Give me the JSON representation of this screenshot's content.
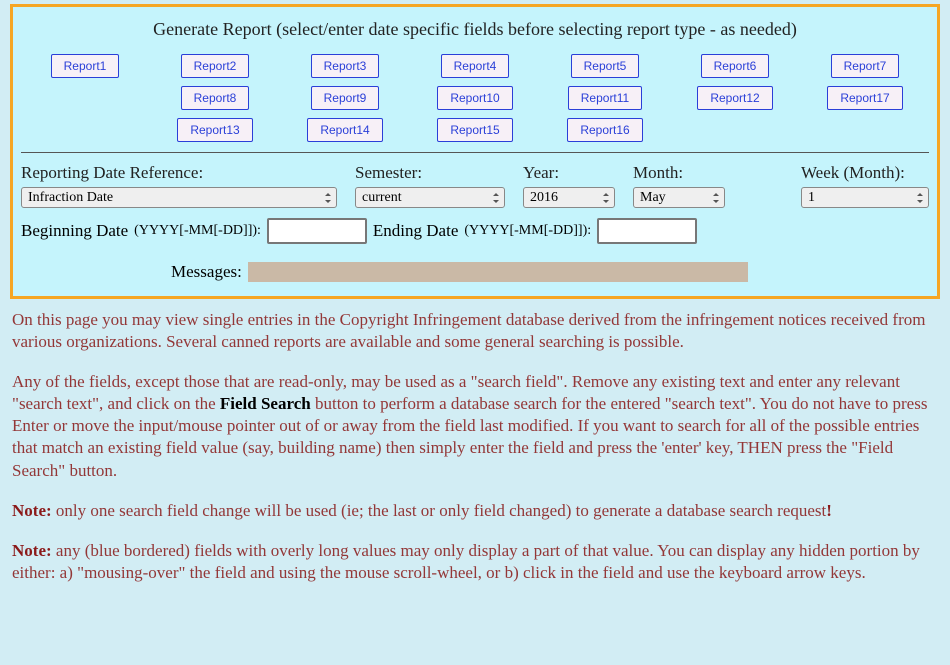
{
  "panel": {
    "title": "Generate Report (select/enter date specific fields before selecting report type - as needed)"
  },
  "reports": [
    [
      "Report1",
      "Report2",
      "Report3",
      "Report4",
      "Report5",
      "Report6",
      "Report7"
    ],
    [
      "",
      "Report8",
      "Report9",
      "Report10",
      "Report11",
      "Report12",
      "Report17"
    ],
    [
      "",
      "Report13",
      "Report14",
      "Report15",
      "Report16",
      "",
      ""
    ]
  ],
  "controls": {
    "reporting_date_ref": {
      "label": "Reporting Date Reference:",
      "value": "Infraction Date"
    },
    "semester": {
      "label": "Semester:",
      "value": "current"
    },
    "year": {
      "label": "Year:",
      "value": "2016"
    },
    "month": {
      "label": "Month:",
      "value": "May"
    },
    "week": {
      "label": "Week (Month):",
      "value": "1"
    }
  },
  "dates": {
    "begin_label": "Beginning Date",
    "begin_fmt": "(YYYY[-MM[-DD]]):",
    "end_label": "Ending Date",
    "end_fmt": "(YYYY[-MM[-DD]]):"
  },
  "messages": {
    "label": "Messages:"
  },
  "prose": {
    "p1": "On this page you may view single entries in the Copyright Infringement database derived from the infringement notices received from various organizations. Several canned reports are available and some general searching is possible.",
    "p2a": "Any of the fields, except those that are read-only, may be used as a \"search field\". Remove any existing text and enter any relevant \"search text\", and click on the ",
    "p2_btn": "Field Search",
    "p2b": " button to perform a database search for the entered \"search text\". You do not have to press Enter or move the input/mouse pointer out of or away from the field last modified. If you want to search for all of the possible entries that match an existing field value (say, building name) then simply enter the field and press the 'enter' key, THEN press the \"Field Search\" button.",
    "note_label": "Note:",
    "p3": " only one search field change will be used (ie; the last or only field changed) to generate a database search request",
    "p3_bang": "!",
    "p4": " any (blue bordered) fields with overly long values may only display a part of that value. You can display any hidden portion by either: a) \"mousing-over\" the field and using the mouse scroll-wheel, or b) click in the field and use the keyboard arrow keys."
  }
}
